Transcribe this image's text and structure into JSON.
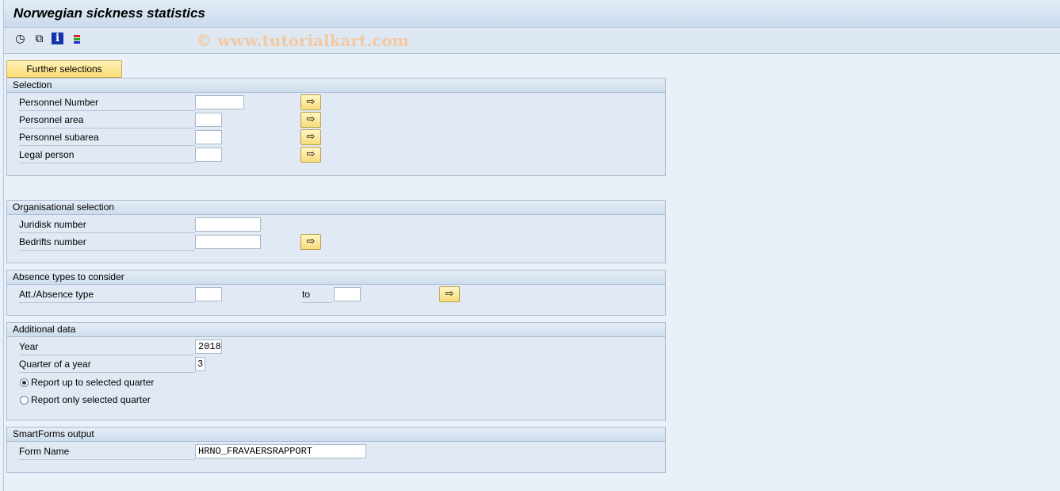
{
  "title": "Norwegian sickness statistics",
  "toolbar": {
    "icons": [
      "execute-clock-icon",
      "variants-icon",
      "info-icon",
      "selection-options-icon"
    ]
  },
  "watermark": "© www.tutorialkart.com",
  "further_selections": "Further selections",
  "selection": {
    "header": "Selection",
    "rows": [
      {
        "label": "Personnel Number",
        "value": ""
      },
      {
        "label": "Personnel area",
        "value": ""
      },
      {
        "label": "Personnel subarea",
        "value": ""
      },
      {
        "label": "Legal person",
        "value": ""
      }
    ]
  },
  "org": {
    "header": "Organisational selection",
    "rows": [
      {
        "label": "Juridisk number",
        "value": ""
      },
      {
        "label": "Bedrifts number",
        "value": ""
      }
    ]
  },
  "absence": {
    "header": "Absence types to consider",
    "label": "Att./Absence type",
    "from": "",
    "to_label": "to",
    "to": ""
  },
  "additional": {
    "header": "Additional data",
    "year_label": "Year",
    "year": "2018",
    "quarter_label": "Quarter of a year",
    "quarter": "3",
    "radio1": "Report up to selected quarter",
    "radio2": "Report only selected quarter",
    "selected": "radio1"
  },
  "smartforms": {
    "header": "SmartForms output",
    "label": "Form Name",
    "value": "HRNO_FRAVAERSRAPPORT"
  }
}
